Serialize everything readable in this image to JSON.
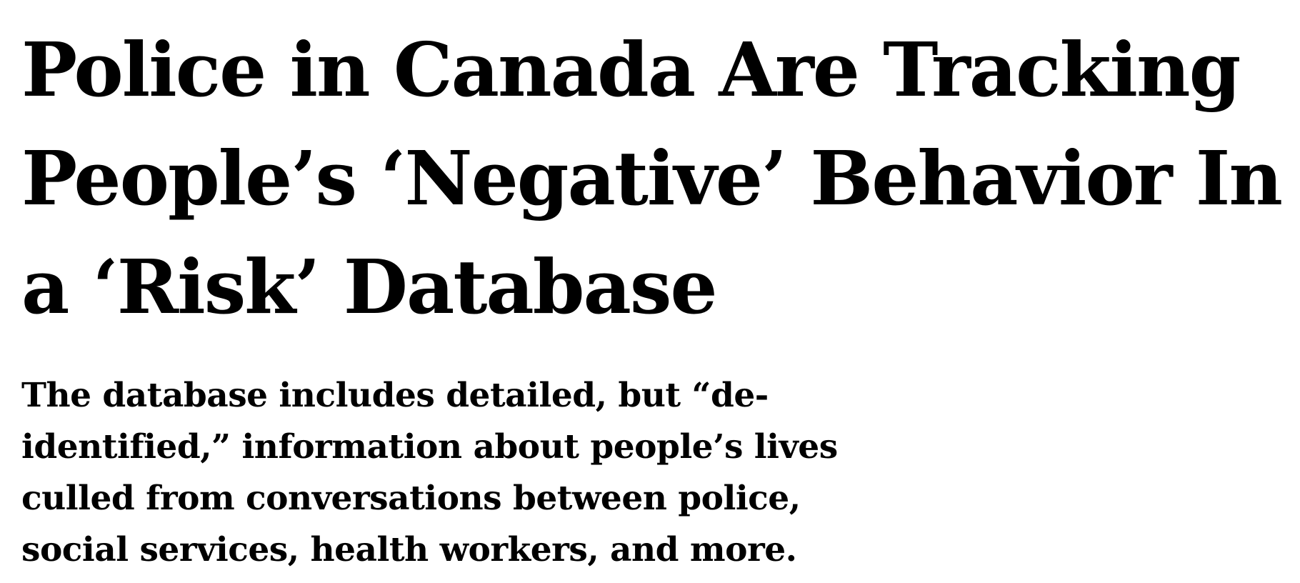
{
  "article": {
    "headline": "Police in Canada Are Tracking People’s ‘Negative’ Behavior In a ‘Risk’ Database",
    "subheadline": "The database includes detailed, but “de-identified,” information about people’s lives culled from conversations between police, social services, health workers, and more."
  }
}
